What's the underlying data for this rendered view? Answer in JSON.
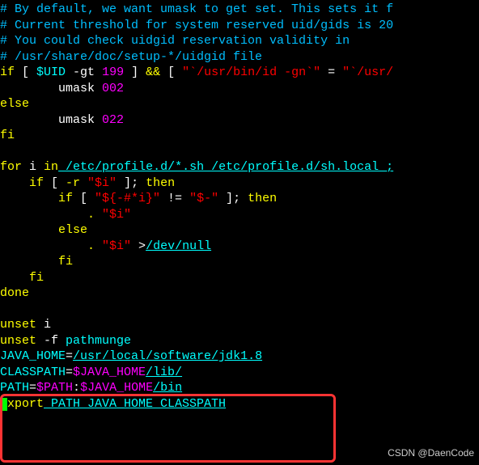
{
  "lines": {
    "c1": "# By default, we want umask to get set. This sets it f",
    "c2": "# Current threshold for system reserved uid/gids is 20",
    "c3": "# You could check uidgid reservation validity in",
    "c4": "# /usr/share/doc/setup-*/uidgid file",
    "if1_kw_if": "if",
    "if1_bracket1": " [ ",
    "if1_var": "$UID",
    "if1_op": " -gt ",
    "if1_num": "199",
    "if1_bracket2": " ] ",
    "if1_and": "&&",
    "if1_bracket3": " [ ",
    "if1_str1": "\"`/usr/bin/id -gn`\"",
    "if1_eq": " = ",
    "if1_str2": "\"`/usr/",
    "umask1_cmd": "        umask ",
    "umask1_val": "002",
    "else_kw": "else",
    "umask2_cmd": "        umask ",
    "umask2_val": "022",
    "fi1": "fi",
    "for_kw_for": "for",
    "for_i": " i ",
    "for_kw_in": "in",
    "for_paths": " /etc/profile.d/*.sh /etc/profile.d/sh.local ;",
    "inner_if_kw": "    if",
    "inner_if_bracket1": " [ ",
    "inner_if_op": "-r ",
    "inner_if_str": "\"$i\"",
    "inner_if_bracket2": " ]; ",
    "inner_if_then": "then",
    "inner2_if_kw": "        if",
    "inner2_if_bracket1": " [ ",
    "inner2_if_str1": "\"${-#*i}\"",
    "inner2_if_neq": " != ",
    "inner2_if_str2": "\"$-\"",
    "inner2_if_bracket2": " ]; ",
    "inner2_if_then": "then",
    "source1_dot": "            . ",
    "source1_str": "\"$i\"",
    "else2_kw": "        else",
    "source2_dot": "            . ",
    "source2_str": "\"$i\"",
    "source2_redir": " >",
    "source2_devnull": "/dev/null",
    "fi2": "        fi",
    "fi3": "    fi",
    "done_kw": "done",
    "unset1_kw": "unset",
    "unset1_i": " i",
    "unset2_kw": "unset",
    "unset2_f": " -f ",
    "unset2_fn": "pathmunge",
    "java_home_var": "JAVA_HOME",
    "java_home_eq": "=",
    "java_home_path": "/usr/local/software/jdk1.8",
    "classpath_var": "CLASSPATH",
    "classpath_eq": "=",
    "classpath_val": "$JAVA_HOME",
    "classpath_lib": "/lib/",
    "path_var": "PATH",
    "path_eq": "=",
    "path_val1": "$PATH",
    "path_colon": ":",
    "path_val2": "$JAVA_HOME",
    "path_bin": "/bin",
    "export_kw": "xport",
    "export_vars": " PATH JAVA_HOME CLASSPATH"
  },
  "watermark": "CSDN @DaenCode"
}
